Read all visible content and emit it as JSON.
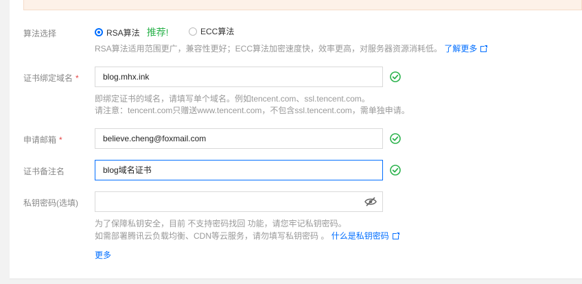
{
  "colors": {
    "accent": "#006eff",
    "success": "#2bb24c",
    "required": "#e54545"
  },
  "algorithm": {
    "label": "算法选择",
    "options": [
      {
        "label": "RSA算法",
        "selected": true
      },
      {
        "label": "ECC算法",
        "selected": false
      }
    ],
    "recommend": "推荐!",
    "hint": "RSA算法适用范围更广，兼容性更好；ECC算法加密速度快，效率更高，对服务器资源消耗低。",
    "learn_more": "了解更多"
  },
  "domain": {
    "label": "证书绑定域名",
    "required_mark": "*",
    "value": "blog.mhx.ink",
    "hint_line1": "即绑定证书的域名，请填写单个域名。例如tencent.com、ssl.tencent.com。",
    "hint_line2": "请注意：tencent.com只赠送www.tencent.com，不包含ssl.tencent.com，需单独申请。"
  },
  "email": {
    "label": "申请邮箱",
    "required_mark": "*",
    "value": "believe.cheng@foxmail.com"
  },
  "remark": {
    "label": "证书备注名",
    "value": "blog域名证书"
  },
  "private_key": {
    "label": "私钥密码(选填)",
    "value": "",
    "hint_line1": "为了保障私钥安全，目前 不支持密码找回 功能，请您牢记私钥密码。",
    "hint_line2": "如需部署腾讯云负载均衡、CDN等云服务，请勿填写私钥密码 。",
    "what_is_link": "什么是私钥密码"
  },
  "more": "更多"
}
